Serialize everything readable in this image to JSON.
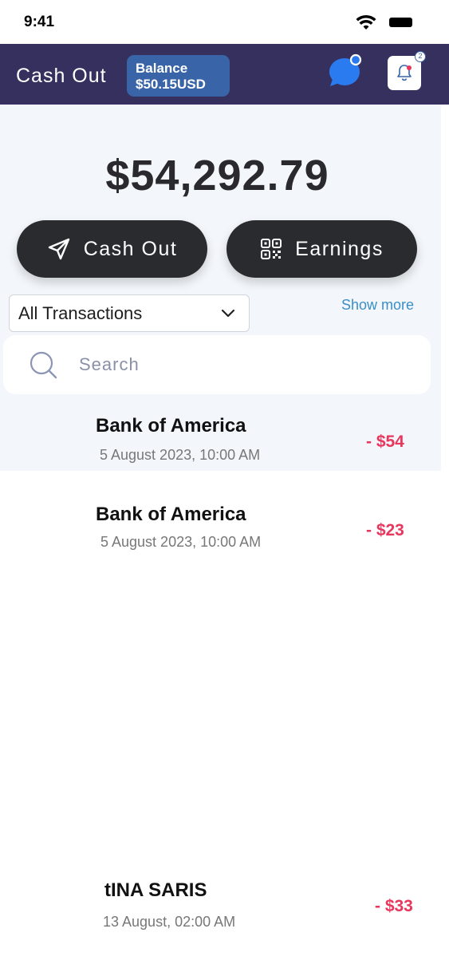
{
  "status_bar": {
    "time": "9:41"
  },
  "header": {
    "title": "Cash Out",
    "balance_label": "Balance",
    "balance_value": "$50.15USD",
    "notification_count": "2"
  },
  "summary": {
    "total_amount": "$54,292.79"
  },
  "actions": {
    "cash_out_label": "Cash Out",
    "earnings_label": "Earnings"
  },
  "filter": {
    "selected": "All Transactions",
    "show_more": "Show more"
  },
  "search": {
    "placeholder": "Search",
    "value": ""
  },
  "transactions": [
    {
      "name": "Bank of America",
      "date": "5 August 2023, 10:00 AM",
      "amount": "- $54"
    },
    {
      "name": "Bank of America",
      "date": "5 August 2023, 10:00 AM",
      "amount": "- $23"
    },
    {
      "name": "tINA SARIS",
      "date": "13 August, 02:00 AM",
      "amount": "- $33"
    }
  ],
  "colors": {
    "header_bg": "#35305e",
    "balance_pill": "#3a64a8",
    "button_bg": "#2a2b2f",
    "debit_amount": "#e8365d",
    "link": "#3a8ec9"
  }
}
